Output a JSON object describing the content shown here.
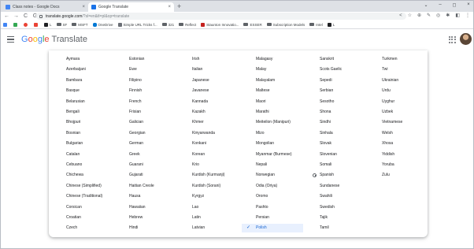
{
  "browser": {
    "tabs": [
      {
        "title": "Class notes - Google Docs",
        "close": "×",
        "active": false
      },
      {
        "title": "Google Translate",
        "close": "×",
        "active": true
      }
    ],
    "new_tab": "+",
    "window_controls": [
      "⌄",
      "–",
      "◻",
      "×"
    ],
    "address": {
      "host": "translate.google.com",
      "path": "/?sl=en&tl=pl&op=translate"
    },
    "nav": {
      "back": "←",
      "forward": "→",
      "reload": "C",
      "home": "G"
    },
    "toolbar_icons": [
      "share-icon",
      "star-icon",
      "extensions-icon",
      "pen-icon",
      "profile-icon",
      "puzzle-icon",
      "sidebar-icon",
      "kebab-menu-icon"
    ],
    "bookmarks": [
      {
        "label": "",
        "icon": "apps-icon"
      },
      {
        "label": "",
        "icon": "google-drive-icon"
      },
      {
        "label": "",
        "icon": "chrome-icon"
      },
      {
        "label": "",
        "icon": "bookmark-red-icon"
      },
      {
        "label": "L",
        "icon": "favicon"
      },
      {
        "label": "SF",
        "icon": "folder-icon"
      },
      {
        "label": "MSFT",
        "icon": "folder-icon"
      },
      {
        "label": "OneDrive",
        "icon": "onedrive-icon"
      },
      {
        "label": "Simple URL Tricks f...",
        "icon": "page-icon"
      },
      {
        "label": "321",
        "icon": "folder-icon"
      },
      {
        "label": "Reflect",
        "icon": "folder-icon"
      },
      {
        "label": "Staunton Innovatio...",
        "icon": "page-icon"
      },
      {
        "label": "ESSER",
        "icon": "folder-icon"
      },
      {
        "label": "Subscription Models",
        "icon": "folder-icon"
      },
      {
        "label": "Intel",
        "icon": "folder-icon"
      },
      {
        "label": "L",
        "icon": "favicon"
      }
    ]
  },
  "app": {
    "brand_google": "Google",
    "brand_product": "Translate"
  },
  "languages": {
    "columns": [
      [
        "Aymara",
        "Azerbaijani",
        "Bambara",
        "Basque",
        "Belarusian",
        "Bengali",
        "Bhojpuri",
        "Bosnian",
        "Bulgarian",
        "Catalan",
        "Cebuano",
        "Chichewa",
        "Chinese (Simplified)",
        "Chinese (Traditional)",
        "Corsican",
        "Croatian",
        "Czech"
      ],
      [
        "Estonian",
        "Ewe",
        "Filipino",
        "Finnish",
        "French",
        "Frisian",
        "Galician",
        "Georgian",
        "German",
        "Greek",
        "Guarani",
        "Gujarati",
        "Haitian Creole",
        "Hausa",
        "Hawaiian",
        "Hebrew",
        "Hindi"
      ],
      [
        "Irish",
        "Italian",
        "Japanese",
        "Javanese",
        "Kannada",
        "Kazakh",
        "Khmer",
        "Kinyarwanda",
        "Konkani",
        "Korean",
        "Krio",
        "Kurdish (Kurmanji)",
        "Kurdish (Sorani)",
        "Kyrgyz",
        "Lao",
        "Latin",
        "Latvian"
      ],
      [
        "Malagasy",
        "Malay",
        "Malayalam",
        "Maltese",
        "Maori",
        "Marathi",
        "Meiteilon (Manipuri)",
        "Mizo",
        "Mongolian",
        "Myanmar (Burmese)",
        "Nepali",
        "Norwegian",
        "Odia (Oriya)",
        "Oromo",
        "Pashto",
        "Persian",
        "Polish"
      ],
      [
        "Sanskrit",
        "Scots Gaelic",
        "Sepedi",
        "Serbian",
        "Sesotho",
        "Shona",
        "Sindhi",
        "Sinhala",
        "Slovak",
        "Slovenian",
        "Somali",
        "Spanish",
        "Sundanese",
        "Swahili",
        "Swedish",
        "Tajik",
        "Tamil"
      ],
      [
        "Turkmen",
        "Twi",
        "Ukrainian",
        "Urdu",
        "Uyghur",
        "Uzbek",
        "Vietnamese",
        "Welsh",
        "Xhosa",
        "Yiddish",
        "Yoruba",
        "Zulu"
      ]
    ],
    "selected": "Polish",
    "recent": "Spanish",
    "check_glyph": "✓"
  },
  "colors": {
    "accent": "#1967d2",
    "selected_bg": "#e8f0fe",
    "google_blue": "#4285f4",
    "google_red": "#ea4335",
    "google_yellow": "#fbbc05",
    "google_green": "#34a853"
  }
}
